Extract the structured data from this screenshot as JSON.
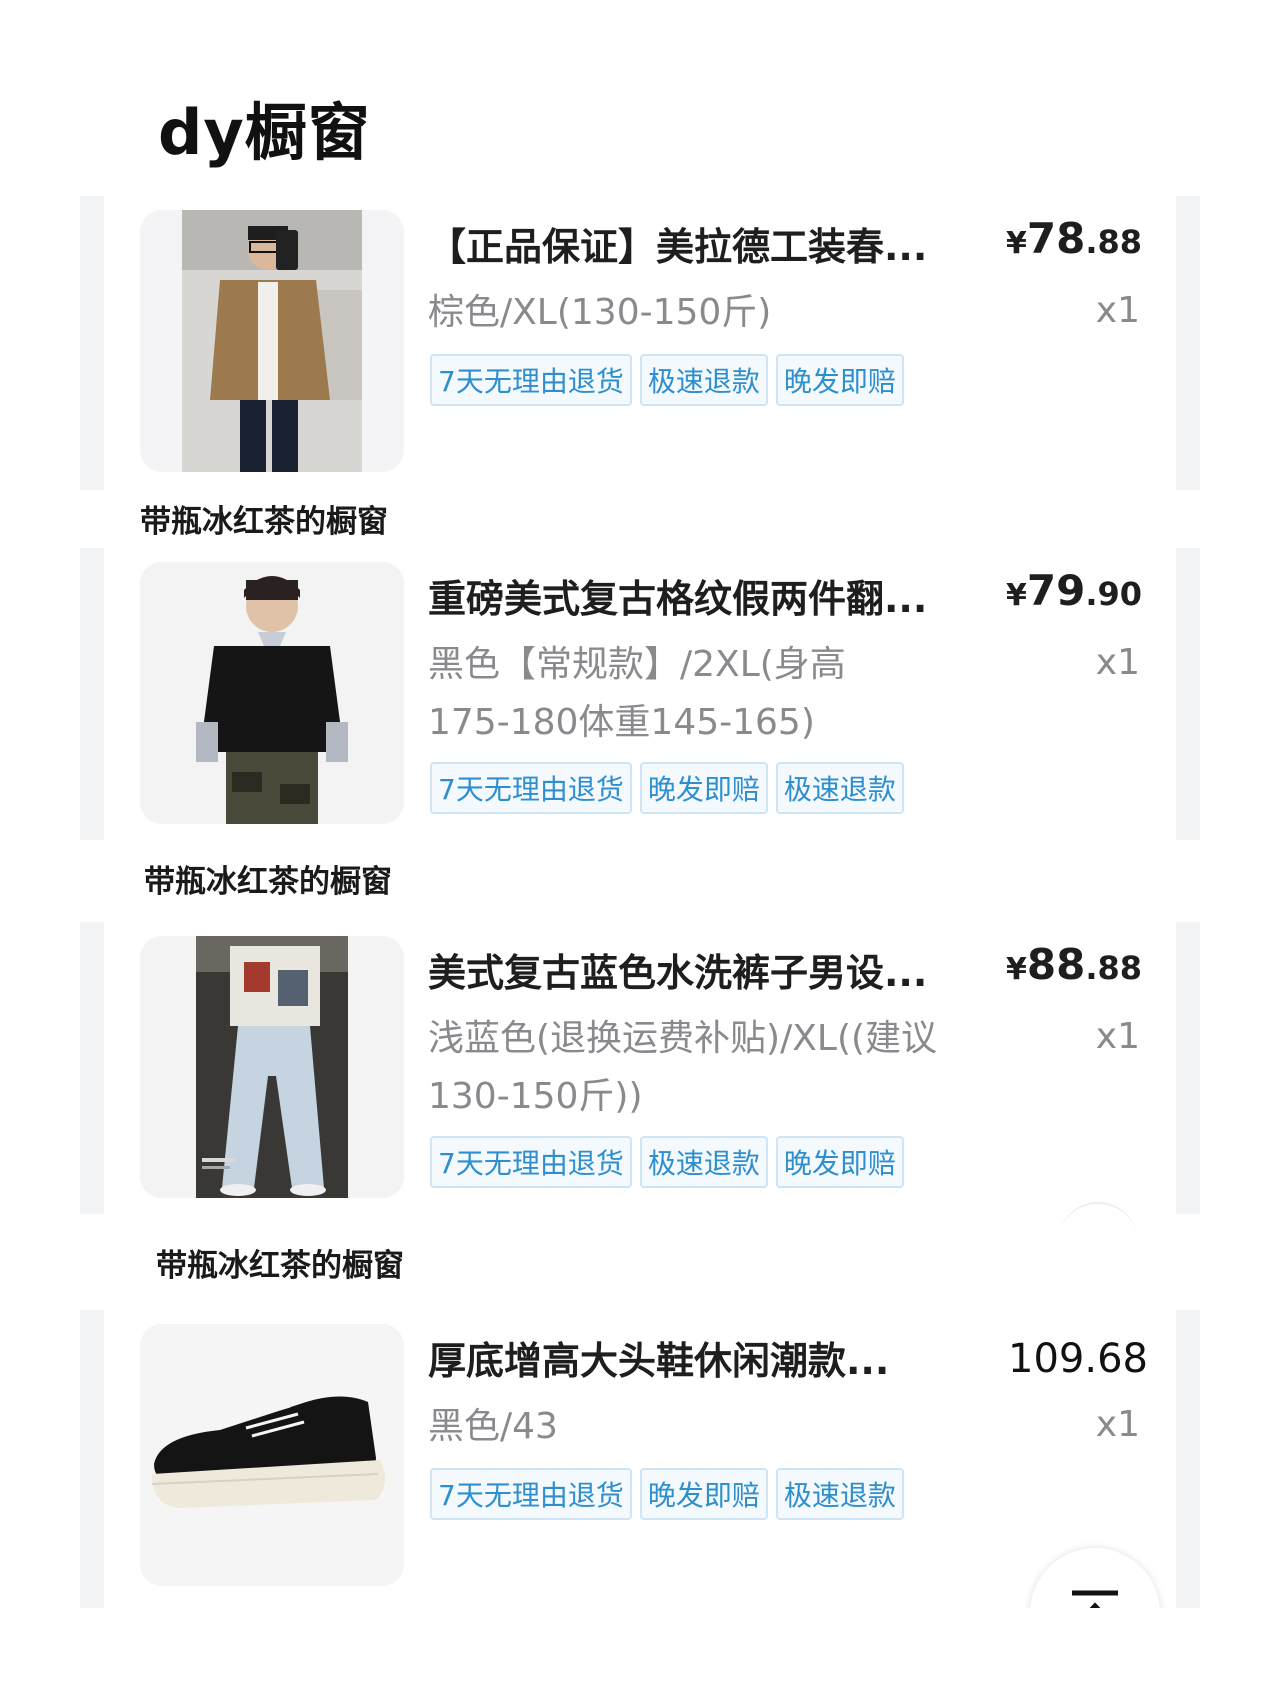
{
  "page": {
    "title": "dy橱窗"
  },
  "shop_label": "带瓶冰红茶的橱窗",
  "products": [
    {
      "title": "【正品保证】美拉德工装春...",
      "price_symbol": "¥",
      "price_int": "78",
      "price_dec": ".88",
      "spec_line1": "棕色/XL(130-150斤)",
      "spec_line2": "",
      "qty": "x1",
      "badges": [
        "7天无理由退货",
        "极速退款",
        "晚发即赔"
      ]
    },
    {
      "title": "重磅美式复古格纹假两件翻...",
      "price_symbol": "¥",
      "price_int": "79",
      "price_dec": ".90",
      "spec_line1": "黑色【常规款】/2XL(身高",
      "spec_line2": "175-180体重145-165)",
      "qty": "x1",
      "badges": [
        "7天无理由退货",
        "晚发即赔",
        "极速退款"
      ]
    },
    {
      "title": "美式复古蓝色水洗裤子男设...",
      "price_symbol": "¥",
      "price_int": "88",
      "price_dec": ".88",
      "spec_line1": "浅蓝色(退换运费补贴)/XL((建议",
      "spec_line2": "130-150斤))",
      "qty": "x1",
      "badges": [
        "7天无理由退货",
        "极速退款",
        "晚发即赔"
      ]
    },
    {
      "title": "厚底增高大头鞋休闲潮款...",
      "price_plain": "109.68",
      "spec_line1": "黑色/43",
      "spec_line2": "",
      "qty": "x1",
      "badges": [
        "7天无理由退货",
        "晚发即赔",
        "极速退款"
      ]
    }
  ],
  "colors": {
    "badge_text": "#2f8fce",
    "badge_border": "#cfe4f4",
    "spec_text": "#8a8a8e"
  },
  "icons": {
    "thumb_1": "man-in-brown-jacket-photo",
    "thumb_2": "man-in-black-sweater-photo",
    "thumb_3": "person-in-light-blue-jeans-photo",
    "thumb_4": "black-white-sneaker-photo",
    "scroll_top": "back-to-top-icon"
  }
}
